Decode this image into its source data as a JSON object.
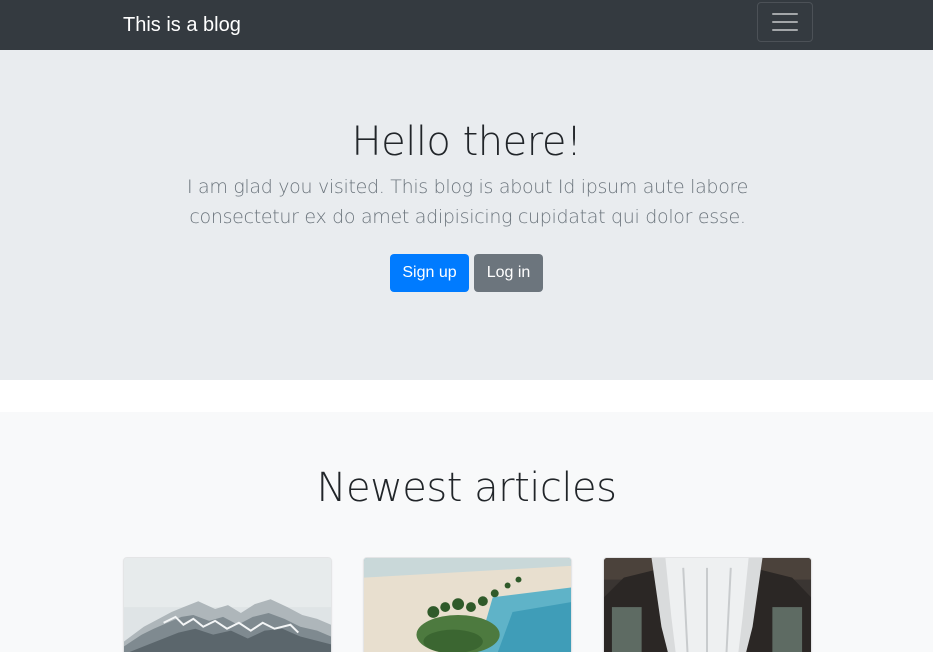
{
  "navbar": {
    "brand": "This is a blog",
    "toggler_icon": "hamburger-menu-icon"
  },
  "hero": {
    "title": "Hello there!",
    "lead": "I am glad you visited. This blog is about Id ipsum aute labore consectetur ex do amet adipisicing cupidatat qui dolor esse.",
    "signup_label": "Sign up",
    "login_label": "Log in"
  },
  "articles": {
    "heading": "Newest articles",
    "cards": [
      {
        "image": "snowy-mountain-image"
      },
      {
        "image": "tropical-island-image"
      },
      {
        "image": "canopy-bed-image"
      }
    ]
  },
  "colors": {
    "navbar_bg": "#343a40",
    "hero_bg": "#e9ecef",
    "primary": "#007bff",
    "secondary": "#6c757d",
    "section_bg": "#f8f9fa"
  }
}
